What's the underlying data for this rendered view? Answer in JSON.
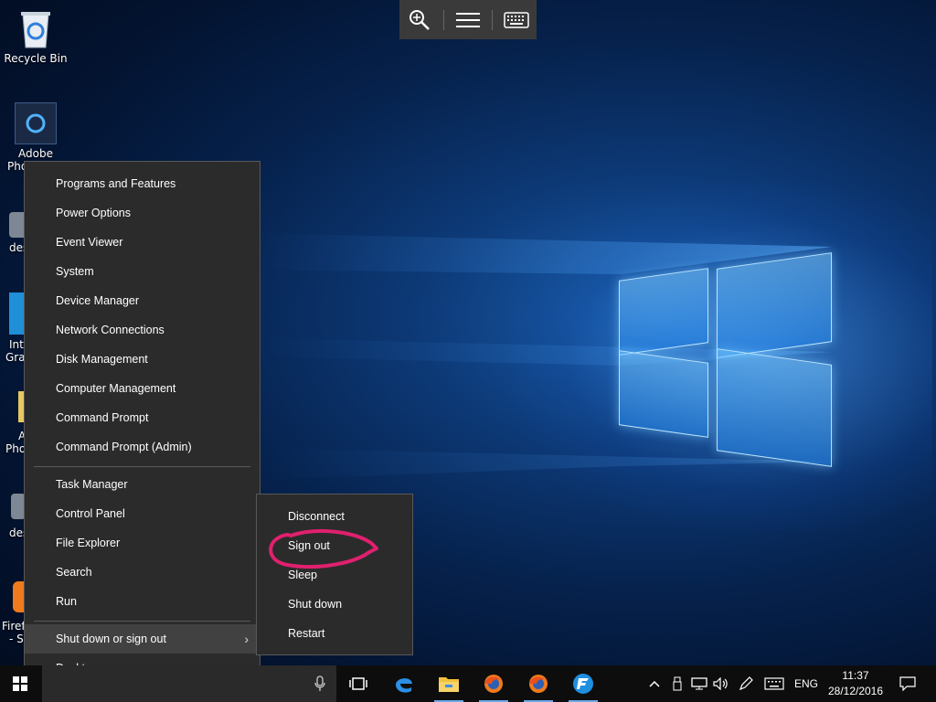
{
  "touch_toolbar": {
    "icons": [
      "magnifier-icon",
      "hamburger-menu-icon",
      "keyboard-icon"
    ]
  },
  "desktop_icons": [
    {
      "label": "Recycle Bin",
      "icon": "recycle-bin-icon"
    },
    {
      "label_line1": "Adobe",
      "label_line2": "Pho",
      "icon": "adobe-photoshop-icon"
    },
    {
      "label_line1": "des",
      "icon": "gear-icon"
    },
    {
      "label_line1": "Int",
      "label_line2": "Grap",
      "icon": "intel-graphics-icon"
    },
    {
      "label_line1": "A",
      "label_line2": "Pho",
      "icon": "folder-icon"
    },
    {
      "label_line1": "des",
      "icon": "gear-icon"
    },
    {
      "label_line1": "Firef",
      "label_line2": "- S",
      "icon": "firefox-icon"
    }
  ],
  "context_menu": {
    "items_group1": [
      "Programs and Features",
      "Power Options",
      "Event Viewer",
      "System",
      "Device Manager",
      "Network Connections",
      "Disk Management",
      "Computer Management",
      "Command Prompt",
      "Command Prompt (Admin)"
    ],
    "items_group2": [
      "Task Manager",
      "Control Panel",
      "File Explorer",
      "Search",
      "Run"
    ],
    "shutdown_label": "Shut down or sign out",
    "desktop_label": "Desktop"
  },
  "submenu": {
    "items": [
      "Disconnect",
      "Sign out",
      "Sleep",
      "Shut down",
      "Restart"
    ]
  },
  "annotation": {
    "color": "#e0206e",
    "target": "Sign out"
  },
  "taskbar": {
    "pinned": [
      "task-view-icon",
      "edge-icon",
      "file-explorer-icon",
      "firefox-icon",
      "firefox-icon",
      "filezilla-icon"
    ],
    "language": "ENG",
    "time": "11:37",
    "date": "28/12/2016"
  }
}
